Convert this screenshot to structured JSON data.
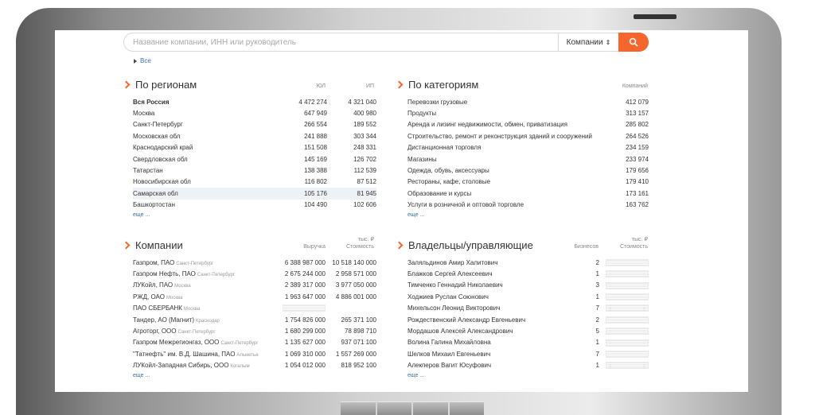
{
  "search": {
    "placeholder": "Название компании, ИНН или руководитель",
    "scope": "Компании",
    "scope_arrow": "⇕"
  },
  "breadcrumb": {
    "label": "Все"
  },
  "regions": {
    "title": "По регионам",
    "col1": "ЮЛ",
    "col2": "ИП",
    "more": "еще ...",
    "rows": [
      {
        "name": "Вся Россия",
        "yl": "4 472 274",
        "ip": "4 321 040"
      },
      {
        "name": "Москва",
        "yl": "647 949",
        "ip": "400 980"
      },
      {
        "name": "Санкт-Петербург",
        "yl": "266 554",
        "ip": "189 552"
      },
      {
        "name": "Московская обл",
        "yl": "241 888",
        "ip": "303 344"
      },
      {
        "name": "Краснодарский край",
        "yl": "151 508",
        "ip": "248 331"
      },
      {
        "name": "Свердловская обл",
        "yl": "145 169",
        "ip": "126 702"
      },
      {
        "name": "Татарстан",
        "yl": "138 388",
        "ip": "112 539"
      },
      {
        "name": "Новосибирская обл",
        "yl": "116 802",
        "ip": "87 512"
      },
      {
        "name": "Самарская обл",
        "yl": "105 176",
        "ip": "81 945"
      },
      {
        "name": "Башкортостан",
        "yl": "104 490",
        "ip": "102 606"
      }
    ]
  },
  "categories": {
    "title": "По категориям",
    "col1": "Компаний",
    "more": "еще ...",
    "rows": [
      {
        "name": "Перевозки грузовые",
        "count": "412 079"
      },
      {
        "name": "Продукты",
        "count": "313 157"
      },
      {
        "name": "Аренда и лизинг недвижимости, обмен, приватизация",
        "count": "285 802"
      },
      {
        "name": "Строительство, ремонт и реконструкция зданий и сооружений",
        "count": "264 526"
      },
      {
        "name": "Дистанционная торговля",
        "count": "234 159"
      },
      {
        "name": "Магазины",
        "count": "233 974"
      },
      {
        "name": "Одежда, обувь, аксессуары",
        "count": "179 656"
      },
      {
        "name": "Рестораны, кафе, столовые",
        "count": "179 410"
      },
      {
        "name": "Образование и курсы",
        "count": "173 161"
      },
      {
        "name": "Услуги в розничной и оптовой торговле",
        "count": "163 762"
      }
    ]
  },
  "companies": {
    "title": "Компании",
    "col1": "Выручка",
    "col2_top": "тыс. ₽",
    "col2": "Стоимость",
    "more": "еще ...",
    "rows": [
      {
        "name": "Газпром, ПАО",
        "city": "Санкт-Петербург",
        "revenue": "6 388 987 000",
        "value": "10 518 140 000"
      },
      {
        "name": "Газпром Нефть, ПАО",
        "city": "Санкт-Петербург",
        "revenue": "2 675 244 000",
        "value": "2 958 571 000"
      },
      {
        "name": "ЛУКойл, ПАО",
        "city": "Москва",
        "revenue": "2 389 317 000",
        "value": "3 977 050 000"
      },
      {
        "name": "РЖД, ОАО",
        "city": "Москва",
        "revenue": "1 963 647 000",
        "value": "4 886 001 000"
      },
      {
        "name": "ПАО СБЕРБАНК",
        "city": "Москва",
        "revenue": "",
        "value": ""
      },
      {
        "name": "Тандер, АО (Магнит)",
        "city": "Краснодар",
        "revenue": "1 754 826 000",
        "value": "265 371 100"
      },
      {
        "name": "Агроторг, ООО",
        "city": "Санкт-Петербург",
        "revenue": "1 680 299 000",
        "value": "78 898 710"
      },
      {
        "name": "Газпром Межрегионгаз, ООО",
        "city": "Санкт-Петербург",
        "revenue": "1 135 627 000",
        "value": "937 071 100"
      },
      {
        "name": "\"Татнефть\" им. В.Д. Шашина, ПАО",
        "city": "Альметьевск",
        "revenue": "1 069 310 000",
        "value": "1 557 269 000"
      },
      {
        "name": "ЛУКойл-Западная Сибирь, ООО",
        "city": "Когалым",
        "revenue": "1 054 012 000",
        "value": "818 952 100"
      }
    ]
  },
  "owners": {
    "title": "Владельцы/управляющие",
    "col1": "Бизнесов",
    "col2_top": "тыс. ₽",
    "col2": "Стоимость",
    "more": "еще ...",
    "rows": [
      {
        "name": "Заляльдинов Амир Халитович",
        "count": "2"
      },
      {
        "name": "Блажков Сергей Алексеевич",
        "count": "1"
      },
      {
        "name": "Тимченко Геннадий Николаевич",
        "count": "3"
      },
      {
        "name": "Ходжиев Руслан Союнович",
        "count": "1"
      },
      {
        "name": "Михельсон Леонид Викторович",
        "count": "7"
      },
      {
        "name": "Рождественский Александр Евгеньевич",
        "count": "2"
      },
      {
        "name": "Мордашов Алексей Александрович",
        "count": "5"
      },
      {
        "name": "Волина Галина Михайловна",
        "count": "1"
      },
      {
        "name": "Шелков Михаил Евгеньевич",
        "count": "7"
      },
      {
        "name": "Алекперов Вагит Юсуфович",
        "count": "1"
      }
    ]
  },
  "colors": {
    "accent": "#f4662b",
    "link": "#3a6fb0"
  }
}
